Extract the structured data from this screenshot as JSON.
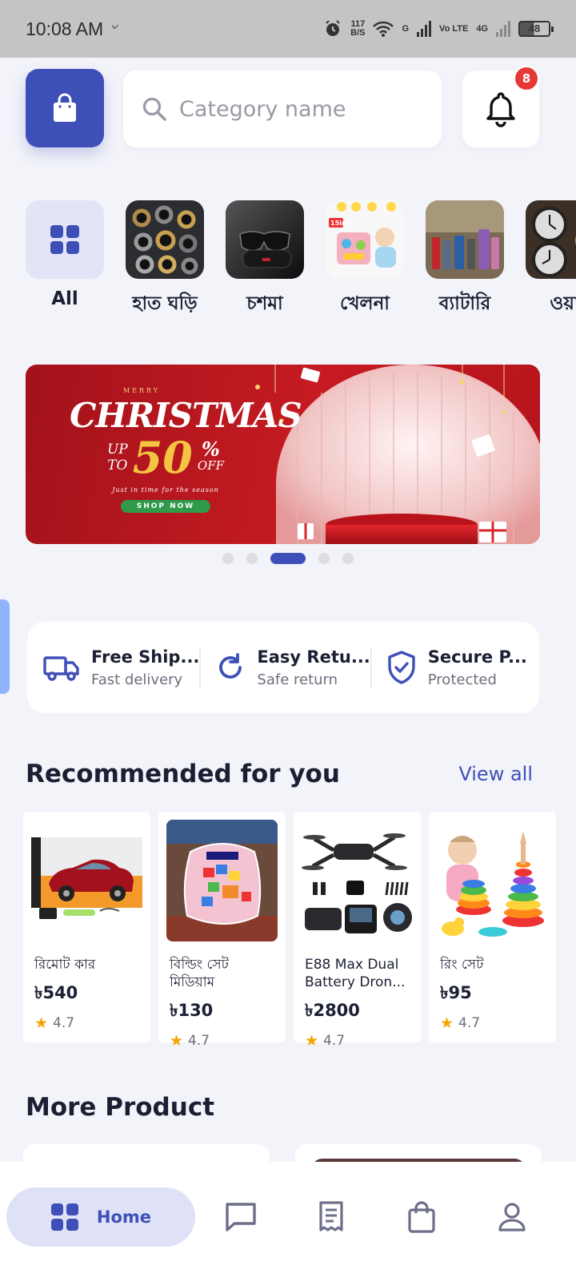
{
  "status_bar": {
    "time": "10:08 AM",
    "speed_value": "117",
    "speed_unit": "B/S",
    "network_label_1": "G",
    "network_label_2": "Vo LTE",
    "network_label_3": "4G",
    "battery": "48"
  },
  "search": {
    "placeholder": "Category name"
  },
  "notifications": {
    "count": "8"
  },
  "categories": [
    {
      "label": "All",
      "icon": "grid-icon"
    },
    {
      "label": "হাত ঘড়ি"
    },
    {
      "label": "চশমা"
    },
    {
      "label": "খেলনা"
    },
    {
      "label": "ব্যাটারি"
    },
    {
      "label": "ওয়া"
    }
  ],
  "banner": {
    "kicker": "MERRY",
    "title": "CHRISTMAS",
    "up": "UP",
    "to": "TO",
    "percent": "50",
    "percent_sign": "%",
    "off": "OFF",
    "tagline": "Just in time for the season",
    "cta": "SHOP NOW"
  },
  "carousel": {
    "total": 5,
    "active_index": 2
  },
  "features": [
    {
      "title": "Free Ship...",
      "subtitle": "Fast delivery",
      "icon": "truck-icon"
    },
    {
      "title": "Easy Retu...",
      "subtitle": "Safe return",
      "icon": "refresh-icon"
    },
    {
      "title": "Secure P...",
      "subtitle": "Protected",
      "icon": "shield-check-icon"
    }
  ],
  "recommended": {
    "title": "Recommended for you",
    "view_all": "View all",
    "products": [
      {
        "name": "রিমোট কার",
        "price": "৳540",
        "rating": "4.7"
      },
      {
        "name": "বিল্ডিং সেট মিডিয়াম",
        "price": "৳130",
        "rating": "4.7"
      },
      {
        "name": "E88 Max Dual Battery Dron...",
        "price": "৳2800",
        "rating": "4.7"
      },
      {
        "name": "রিং সেট",
        "price": "৳95",
        "rating": "4.7"
      }
    ]
  },
  "more_products": {
    "title": "More Product"
  },
  "bottom_nav": {
    "home": "Home",
    "items": [
      "chat-icon",
      "orders-icon",
      "bag-icon",
      "profile-icon"
    ]
  },
  "colors": {
    "primary": "#3e4fb8",
    "background": "#f3f4fa",
    "badge": "#e53935",
    "star": "#f5a300"
  }
}
